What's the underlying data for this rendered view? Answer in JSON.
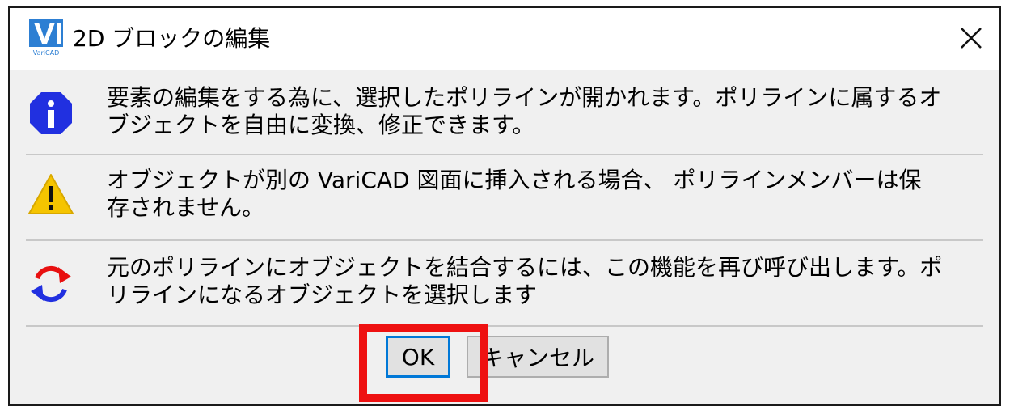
{
  "dialog": {
    "title": "2D ブロックの編集",
    "app_logo_text": "VariCAD",
    "close_label": "Close"
  },
  "messages": [
    {
      "icon": "info-icon",
      "line1": "要素の編集をする為に、選択したポリラインが開かれます。ポリラインに属するオ",
      "line2": "ブジェクトを自由に変換、修正できます。"
    },
    {
      "icon": "warning-icon",
      "line1": "オブジェクトが別の VariCAD 図面に挿入される場合、 ポリラインメンバーは保",
      "line2": "存されません。"
    },
    {
      "icon": "refresh-icon",
      "line1": "元のポリラインにオブジェクトを結合するには、この機能を再び呼び出します。ポ",
      "line2": "リラインになるオブジェクトを選択します"
    }
  ],
  "buttons": {
    "ok": "OK",
    "cancel": "キャンセル"
  },
  "colors": {
    "info": "#2130e0",
    "warning": "#f5c400",
    "highlight": "#ee1111",
    "focus": "#0078d7"
  }
}
